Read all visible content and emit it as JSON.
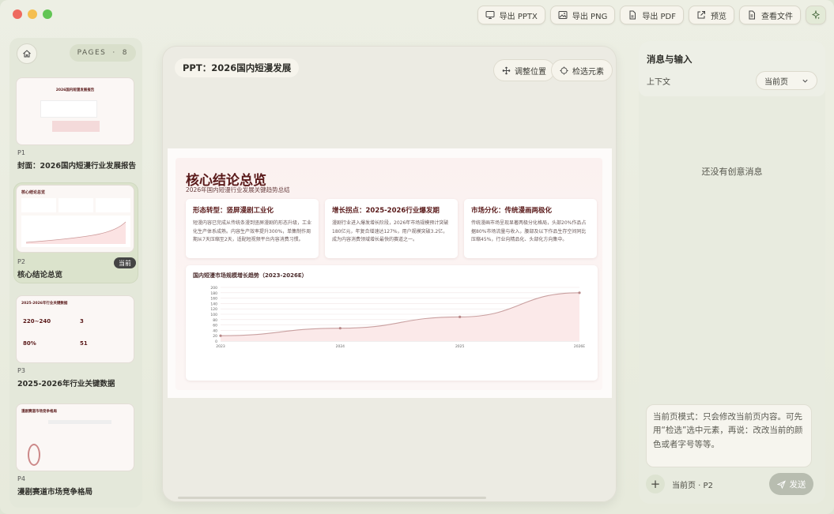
{
  "toolbar": {
    "export_pptx": "导出 PPTX",
    "export_png": "导出 PNG",
    "export_pdf": "导出 PDF",
    "preview": "预览",
    "view_files": "查看文件"
  },
  "pages": {
    "label": "PAGES",
    "count": "8",
    "items": [
      {
        "num": "P1",
        "title": "封面：2026国内短漫行业发展报告",
        "thumb_title": "2026国内短漫发展报告"
      },
      {
        "num": "P2",
        "title": "核心结论总览",
        "badge": "当前",
        "thumb_title": "核心结论总览"
      },
      {
        "num": "P3",
        "title": "2025-2026年行业关键数据",
        "thumb_title": "2025-2026年行业关键数据",
        "thumb_stats": [
          "220~240",
          "3",
          "80%",
          "51"
        ]
      },
      {
        "num": "P4",
        "title": "漫剧赛道市场竞争格局",
        "thumb_title": "漫剧赛道市场竞争格局"
      }
    ]
  },
  "editor": {
    "title": "PPT：2026国内短漫发展",
    "adjust_button": "调整位置",
    "pick_button": "检选元素"
  },
  "slide": {
    "title": "核心结论总览",
    "subtitle": "2026年国内短漫行业发展关键趋势总结",
    "cards": [
      {
        "title": "形态转型：竖屏漫剧工业化",
        "body": "短漫内容已完成从传统条漫到竖屏漫剧的形态升级，工业化生产体系成熟。内容生产效率提升300%，单集制作周期从7天压缩至2天，适配短视频平台内容消费习惯。"
      },
      {
        "title": "增长拐点：2025-2026行业爆发期",
        "body": "漫剧行业进入爆发增长阶段，2026年市场规模预计突破180亿元，年复合增速达127%，用户规模突破3.2亿，成为内容消费领域增长最快的赛道之一。"
      },
      {
        "title": "市场分化：传统漫画两极化",
        "body": "传统漫画市场呈现显著两极分化格局，头部20%作品占据80%市场流量与收入，腰部及以下作品生存空间同比压缩45%，行业向精品化、头部化方向集中。"
      }
    ]
  },
  "chart_data": {
    "type": "line",
    "title": "国内短漫市场规模增长趋势（2023-2026E）",
    "categories": [
      "2023",
      "2024",
      "2025",
      "2026E"
    ],
    "series": [
      {
        "values": [
          20,
          48,
          90,
          180
        ]
      }
    ],
    "y_ticks": [
      0,
      20,
      40,
      60,
      80,
      100,
      120,
      140,
      160,
      180,
      200
    ],
    "ylim": [
      0,
      200
    ],
    "area_fill": true,
    "grid": true,
    "line_color": "#c9a0a0",
    "fill_color": "#fbe9e9"
  },
  "panel": {
    "title": "消息与输入",
    "context_label": "上下文",
    "context_value": "当前页",
    "empty_text": "还没有创意消息",
    "input_text": "当前页模式：只会修改当前页内容。可先用“检选”选中元素，再说：改改当前的颜色或者字号等等。",
    "status": "当前页 · P2",
    "send": "发送"
  }
}
